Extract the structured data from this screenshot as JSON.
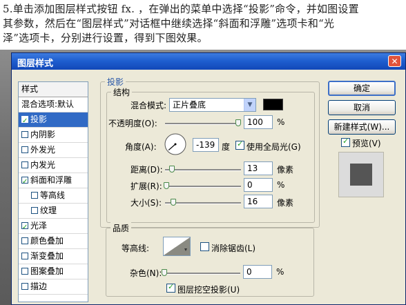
{
  "instructions": {
    "line1": "5.单击添加图层样式按钮 fx. ，在弹出的菜单中选择“投影”命令，并如图设置",
    "line2": "其参数，然后在“图层样式”对话框中继续选择“斜面和浮雕”选项卡和“光",
    "line3": "泽”选项卡，分别进行设置，得到下图效果。"
  },
  "dialog": {
    "title": "图层样式",
    "close_icon": "close-icon"
  },
  "style_list": {
    "header": "样式",
    "blend_options": "混合选项:默认",
    "items": [
      {
        "label": "投影",
        "checked": true,
        "selected": true
      },
      {
        "label": "内阴影",
        "checked": false
      },
      {
        "label": "外发光",
        "checked": false
      },
      {
        "label": "内发光",
        "checked": false
      },
      {
        "label": "斜面和浮雕",
        "checked": true
      },
      {
        "label": "等高线",
        "checked": false,
        "sub": true
      },
      {
        "label": "纹理",
        "checked": false,
        "sub": true
      },
      {
        "label": "光泽",
        "checked": true
      },
      {
        "label": "颜色叠加",
        "checked": false
      },
      {
        "label": "渐变叠加",
        "checked": false
      },
      {
        "label": "图案叠加",
        "checked": false
      },
      {
        "label": "描边",
        "checked": false
      }
    ]
  },
  "drop_shadow": {
    "section_title": "投影",
    "structure_title": "结构",
    "blend_mode_label": "混合模式:",
    "blend_mode_value": "正片叠底",
    "blend_color": "#000000",
    "opacity_label": "不透明度(O):",
    "opacity_value": "100",
    "opacity_level": 1.0,
    "percent": "%",
    "angle_label": "角度(A):",
    "angle_value": "-139",
    "angle_unit": "度",
    "global_light_label": "使用全局光(G)",
    "global_light_checked": true,
    "distance_label": "距离(D):",
    "distance_value": "13",
    "spread_label": "扩展(R):",
    "spread_value": "0",
    "size_label": "大小(S):",
    "size_value": "16",
    "px_unit": "像素",
    "quality_title": "品质",
    "contour_label": "等高线:",
    "anti_alias_label": "消除锯齿(L)",
    "anti_alias_checked": false,
    "noise_label": "杂色(N):",
    "noise_value": "0",
    "knockout_label": "图层挖空投影(U)",
    "knockout_checked": true
  },
  "buttons": {
    "ok": "确定",
    "cancel": "取消",
    "new_style": "新建样式(W)...",
    "preview_label": "预览(V)",
    "preview_checked": true
  },
  "colors": {
    "title_bar": "#1f5fd0",
    "selection": "#316ac5",
    "dialog_bg": "#ece9d8"
  }
}
